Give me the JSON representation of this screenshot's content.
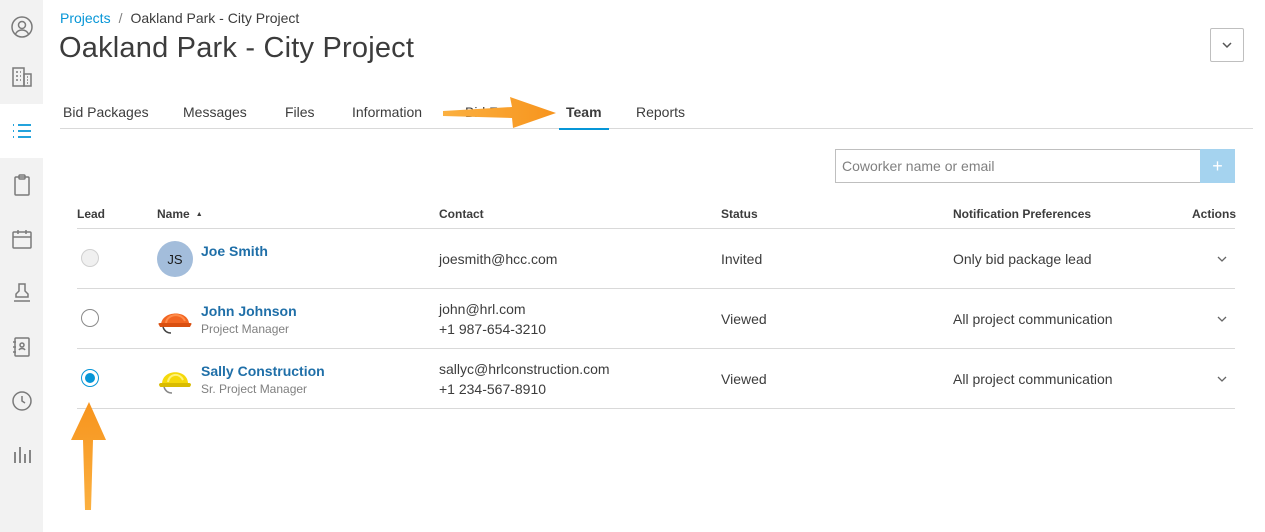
{
  "sidebar": {
    "items": [
      {
        "icon": "user-circle-icon"
      },
      {
        "icon": "building-icon"
      },
      {
        "icon": "list-icon",
        "active": true
      },
      {
        "icon": "clipboard-icon"
      },
      {
        "icon": "calendar-icon"
      },
      {
        "icon": "stamp-icon"
      },
      {
        "icon": "address-book-icon"
      },
      {
        "icon": "clock-icon"
      },
      {
        "icon": "bar-chart-icon"
      }
    ]
  },
  "breadcrumb": {
    "root": "Projects",
    "separator": "/",
    "current": "Oakland Park - City Project"
  },
  "page_title": "Oakland Park - City Project",
  "tabs": [
    {
      "label": "Bid Packages"
    },
    {
      "label": "Messages"
    },
    {
      "label": "Files"
    },
    {
      "label": "Information"
    },
    {
      "label": "Bid F"
    },
    {
      "label": "Team",
      "active": true
    },
    {
      "label": "Reports"
    }
  ],
  "search": {
    "placeholder": "Coworker name or email",
    "add_label": "+"
  },
  "table": {
    "headers": {
      "lead": "Lead",
      "name": "Name",
      "contact": "Contact",
      "status": "Status",
      "notifications": "Notification Preferences",
      "actions": "Actions"
    },
    "rows": [
      {
        "lead": "disabled",
        "initials": "JS",
        "name": "Joe Smith",
        "role": "",
        "email": "joesmith@hcc.com",
        "phone": "",
        "status": "Invited",
        "notifications": "Only bid package lead"
      },
      {
        "lead": "unchecked",
        "avatar": "orange-hard-hat",
        "name": "John Johnson",
        "role": "Project Manager",
        "email": "john@hrl.com",
        "phone": "+1 987-654-3210",
        "status": "Viewed",
        "notifications": "All project communication"
      },
      {
        "lead": "checked",
        "avatar": "yellow-hard-hat",
        "name": "Sally Construction",
        "role": "Sr. Project Manager",
        "email": "sallyc@hrlconstruction.com",
        "phone": "+1 234-567-8910",
        "status": "Viewed",
        "notifications": "All project communication"
      }
    ]
  },
  "colors": {
    "accent": "#0696d7",
    "name_link": "#1f6fa8",
    "annotation_arrow": "#f7941d"
  }
}
